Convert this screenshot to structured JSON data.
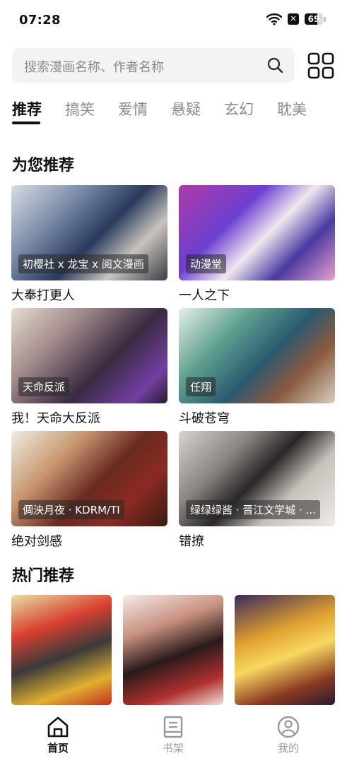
{
  "status_bar": {
    "time": "07:28",
    "battery": "69",
    "battery_level_percent": 69,
    "icons": [
      "wifi-icon",
      "close-box-icon",
      "battery-icon"
    ]
  },
  "search": {
    "placeholder": "搜索漫画名称、作者名称"
  },
  "tabs": [
    {
      "label": "推荐",
      "active": true
    },
    {
      "label": "搞笑",
      "active": false
    },
    {
      "label": "爱情",
      "active": false
    },
    {
      "label": "悬疑",
      "active": false
    },
    {
      "label": "玄幻",
      "active": false
    },
    {
      "label": "耽美",
      "active": false
    }
  ],
  "recommend": {
    "title": "为您推荐",
    "items": [
      {
        "title": "大奉打更人",
        "tag": "初樱社 x 龙宝 x 阅文漫画"
      },
      {
        "title": "一人之下",
        "tag": "动漫堂"
      },
      {
        "title": "我！天命大反派",
        "tag": "天命反派"
      },
      {
        "title": "斗破苍穹",
        "tag": "任翔"
      },
      {
        "title": "绝对剑感",
        "tag": "倜泱月夜 · KDRM/TI"
      },
      {
        "title": "错撩",
        "tag": "绿绿绿酱 · 晋江文学城 · ..."
      }
    ]
  },
  "hot": {
    "title": "热门推荐"
  },
  "bottom_nav": [
    {
      "label": "首页",
      "icon": "home-icon",
      "active": true
    },
    {
      "label": "书架",
      "icon": "bookshelf-icon",
      "active": false
    },
    {
      "label": "我的",
      "icon": "profile-icon",
      "active": false
    }
  ],
  "colors": {
    "accent": "#111111",
    "inactive": "#8c8c8c",
    "search_bg": "#f3f3f3"
  }
}
